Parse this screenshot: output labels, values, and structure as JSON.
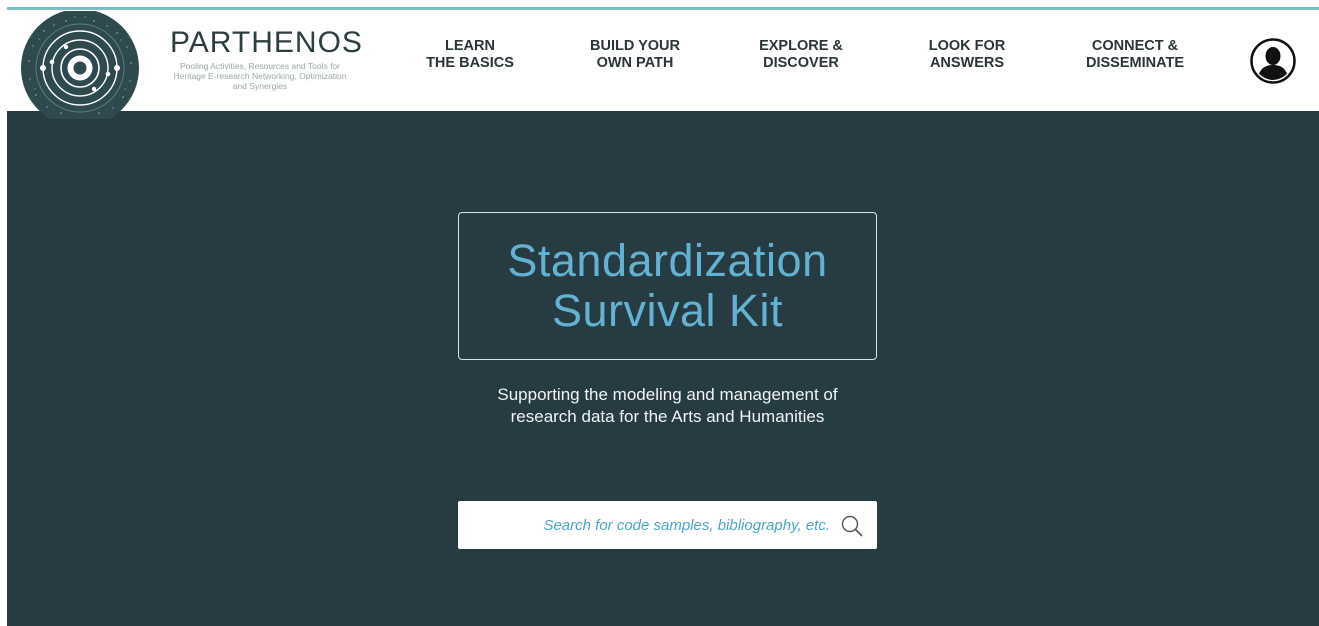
{
  "brand": {
    "title": "PARTHENOS",
    "subtitle": "Pooling Activities, Resources and Tools for Heritage E-research Networking, Optimization and Synergies"
  },
  "nav": {
    "items": [
      {
        "label": "LEARN\nTHE BASICS"
      },
      {
        "label": "BUILD YOUR\nOWN PATH"
      },
      {
        "label": "EXPLORE &\nDISCOVER"
      },
      {
        "label": "LOOK FOR\nANSWERS"
      },
      {
        "label": "CONNECT &\nDISSEMINATE"
      }
    ],
    "user_icon": "user-avatar-icon"
  },
  "hero": {
    "title_line1": "Standardization",
    "title_line2": "Survival Kit",
    "tagline_line1": "Supporting the modeling and management of",
    "tagline_line2": "research data for the Arts and Humanities"
  },
  "search": {
    "placeholder": "Search for code samples, bibliography, etc.",
    "value": "",
    "icon": "search-icon"
  },
  "colors": {
    "top_rule": "#7cbcc7",
    "hero_background": "#263b42",
    "accent_blue": "#63b2d3",
    "logo_dark": "#2e4a4f",
    "nav_text": "#2a3538"
  }
}
